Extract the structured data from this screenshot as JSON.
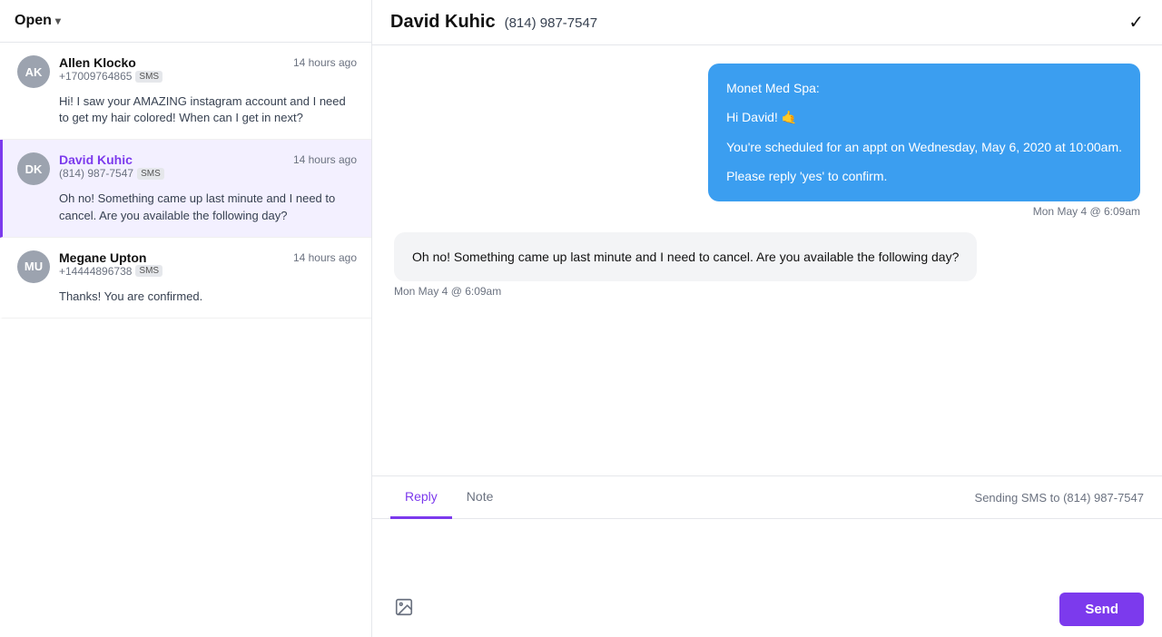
{
  "leftPanel": {
    "header": {
      "openLabel": "Open",
      "chevron": "▾"
    },
    "conversations": [
      {
        "id": "allen-klocko",
        "initials": "AK",
        "name": "Allen Klocko",
        "time": "14 hours ago",
        "phone": "+17009764865",
        "smsBadge": "SMS",
        "preview": "Hi! I saw your AMAZING instagram account and I need to get my hair colored! When can I get in next?",
        "active": false
      },
      {
        "id": "david-kuhic",
        "initials": "DK",
        "name": "David Kuhic",
        "time": "14 hours ago",
        "phone": "(814) 987-7547",
        "smsBadge": "SMS",
        "preview": "Oh no! Something came up last minute and I need to cancel. Are you available the following day?",
        "active": true
      },
      {
        "id": "megane-upton",
        "initials": "MU",
        "name": "Megane Upton",
        "time": "14 hours ago",
        "phone": "+14444896738",
        "smsBadge": "SMS",
        "preview": "Thanks! You are confirmed.",
        "active": false
      }
    ]
  },
  "rightPanel": {
    "header": {
      "name": "David Kuhic",
      "phone": "(814) 987-7547",
      "checkIcon": "✓"
    },
    "messages": [
      {
        "id": "msg-outbound-1",
        "type": "outbound",
        "sender": "Monet Med Spa:",
        "lines": [
          "Monet Med Spa:",
          "Hi David! 🤙",
          "You're scheduled for an appt on Wednesday, May 6, 2020 at 10:00am.",
          "Please reply 'yes' to confirm."
        ],
        "time": "Mon May 4 @ 6:09am"
      },
      {
        "id": "msg-inbound-1",
        "type": "inbound",
        "text": "Oh no! Something came up last minute and I need to cancel. Are you available the following day?",
        "time": "Mon May 4 @ 6:09am"
      }
    ],
    "replyArea": {
      "tabs": [
        {
          "id": "reply",
          "label": "Reply",
          "active": true
        },
        {
          "id": "note",
          "label": "Note",
          "active": false
        }
      ],
      "sendingInfo": "Sending SMS to (814) 987-7547",
      "placeholder": "",
      "sendLabel": "Send",
      "imageIconTitle": "Attach image"
    }
  }
}
